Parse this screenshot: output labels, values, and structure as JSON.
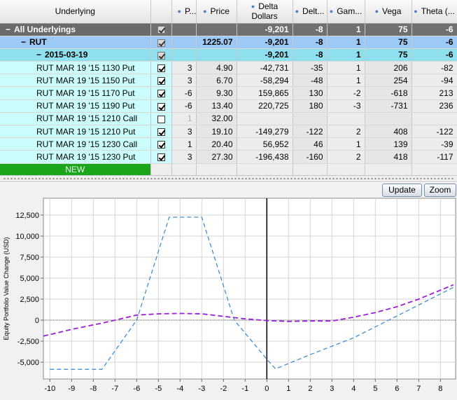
{
  "columns": {
    "underlying": "Underlying",
    "position": "P...",
    "price": "Price",
    "delta_dollars_1": "Delta",
    "delta_dollars_2": "Dollars",
    "delta": "Delt...",
    "gamma": "Gam...",
    "vega": "Vega",
    "theta": "Theta (..."
  },
  "summary_rows": [
    {
      "label": "All Underlyings",
      "prefix": "−",
      "checked": true,
      "position": "",
      "price": "",
      "delta_dollars": "-9,201",
      "delta": "-8",
      "gamma": "1",
      "vega": "75",
      "theta": "-6"
    },
    {
      "label": "RUT",
      "prefix": "−",
      "checked": true,
      "position": "",
      "price": "1225.07",
      "delta_dollars": "-9,201",
      "delta": "-8",
      "gamma": "1",
      "vega": "75",
      "theta": "-6"
    },
    {
      "label": "2015-03-19",
      "prefix": "−",
      "checked": true,
      "position": "",
      "price": "",
      "delta_dollars": "-9,201",
      "delta": "-8",
      "gamma": "1",
      "vega": "75",
      "theta": "-6"
    }
  ],
  "positions": [
    {
      "label": "RUT MAR 19 '15 1130 Put",
      "checked": true,
      "position": "3",
      "price": "4.90",
      "delta_dollars": "-42,731",
      "delta": "-35",
      "gamma": "1",
      "vega": "206",
      "theta": "-82"
    },
    {
      "label": "RUT MAR 19 '15 1150 Put",
      "checked": true,
      "position": "3",
      "price": "6.70",
      "delta_dollars": "-58,294",
      "delta": "-48",
      "gamma": "1",
      "vega": "254",
      "theta": "-94"
    },
    {
      "label": "RUT MAR 19 '15 1170 Put",
      "checked": true,
      "position": "-6",
      "price": "9.30",
      "delta_dollars": "159,865",
      "delta": "130",
      "gamma": "-2",
      "vega": "-618",
      "theta": "213"
    },
    {
      "label": "RUT MAR 19 '15 1190 Put",
      "checked": true,
      "position": "-6",
      "price": "13.40",
      "delta_dollars": "220,725",
      "delta": "180",
      "gamma": "-3",
      "vega": "-731",
      "theta": "236"
    },
    {
      "label": "RUT MAR 19 '15 1210 Call",
      "checked": false,
      "position": "1",
      "price": "32.00",
      "delta_dollars": "",
      "delta": "",
      "gamma": "",
      "vega": "",
      "theta": ""
    },
    {
      "label": "RUT MAR 19 '15 1210 Put",
      "checked": true,
      "position": "3",
      "price": "19.10",
      "delta_dollars": "-149,279",
      "delta": "-122",
      "gamma": "2",
      "vega": "408",
      "theta": "-122"
    },
    {
      "label": "RUT MAR 19 '15 1230 Call",
      "checked": true,
      "position": "1",
      "price": "20.40",
      "delta_dollars": "56,952",
      "delta": "46",
      "gamma": "1",
      "vega": "139",
      "theta": "-39"
    },
    {
      "label": "RUT MAR 19 '15 1230 Put",
      "checked": true,
      "position": "3",
      "price": "27.30",
      "delta_dollars": "-196,438",
      "delta": "-160",
      "gamma": "2",
      "vega": "418",
      "theta": "-117"
    }
  ],
  "new_row_label": "NEW",
  "buttons": {
    "update": "Update",
    "zoom": "Zoom"
  },
  "chart_data": {
    "type": "line",
    "title": "",
    "xlabel": "",
    "ylabel": "Equity Portfolio Value Change (USD)",
    "xlim": [
      -10.3,
      8.7
    ],
    "ylim": [
      -7000,
      14500
    ],
    "x_ticks": [
      -10,
      -9,
      -8,
      -7,
      -6,
      -5,
      -4,
      -3,
      -2,
      -1,
      0,
      1,
      2,
      3,
      4,
      5,
      6,
      7,
      8
    ],
    "y_ticks": [
      -5000,
      -2500,
      0,
      2500,
      5000,
      7500,
      10000,
      12500
    ],
    "y_tick_labels": [
      "-5,000",
      "-2,500",
      "0",
      "2,500",
      "5,000",
      "7,500",
      "10,000",
      "12,500"
    ],
    "grid": true,
    "colors": {
      "series_blue": "#3d8fd6",
      "series_purple": "#9c1fd9",
      "zero_line": "#000000"
    },
    "series": [
      {
        "style": "dashed-blue",
        "x": [
          -10.0,
          -7.6,
          -6.0,
          -4.5,
          -3.0,
          -1.5,
          0.0,
          0.4,
          2.0,
          4.0,
          6.0,
          8.6
        ],
        "y": [
          -5850,
          -5850,
          0,
          12250,
          12250,
          0,
          -4650,
          -5800,
          -4100,
          -2100,
          500,
          3900
        ]
      },
      {
        "style": "dashed-purple",
        "x": [
          -10.3,
          -9.0,
          -7.5,
          -6.0,
          -5.0,
          -4.0,
          -3.0,
          -2.0,
          -1.0,
          0.0,
          1.0,
          2.0,
          3.0,
          4.0,
          5.0,
          6.0,
          7.0,
          8.6
        ],
        "y": [
          -1900,
          -1100,
          -300,
          600,
          750,
          800,
          750,
          450,
          150,
          -50,
          -150,
          -100,
          -100,
          350,
          900,
          1600,
          2500,
          4200
        ]
      }
    ]
  }
}
